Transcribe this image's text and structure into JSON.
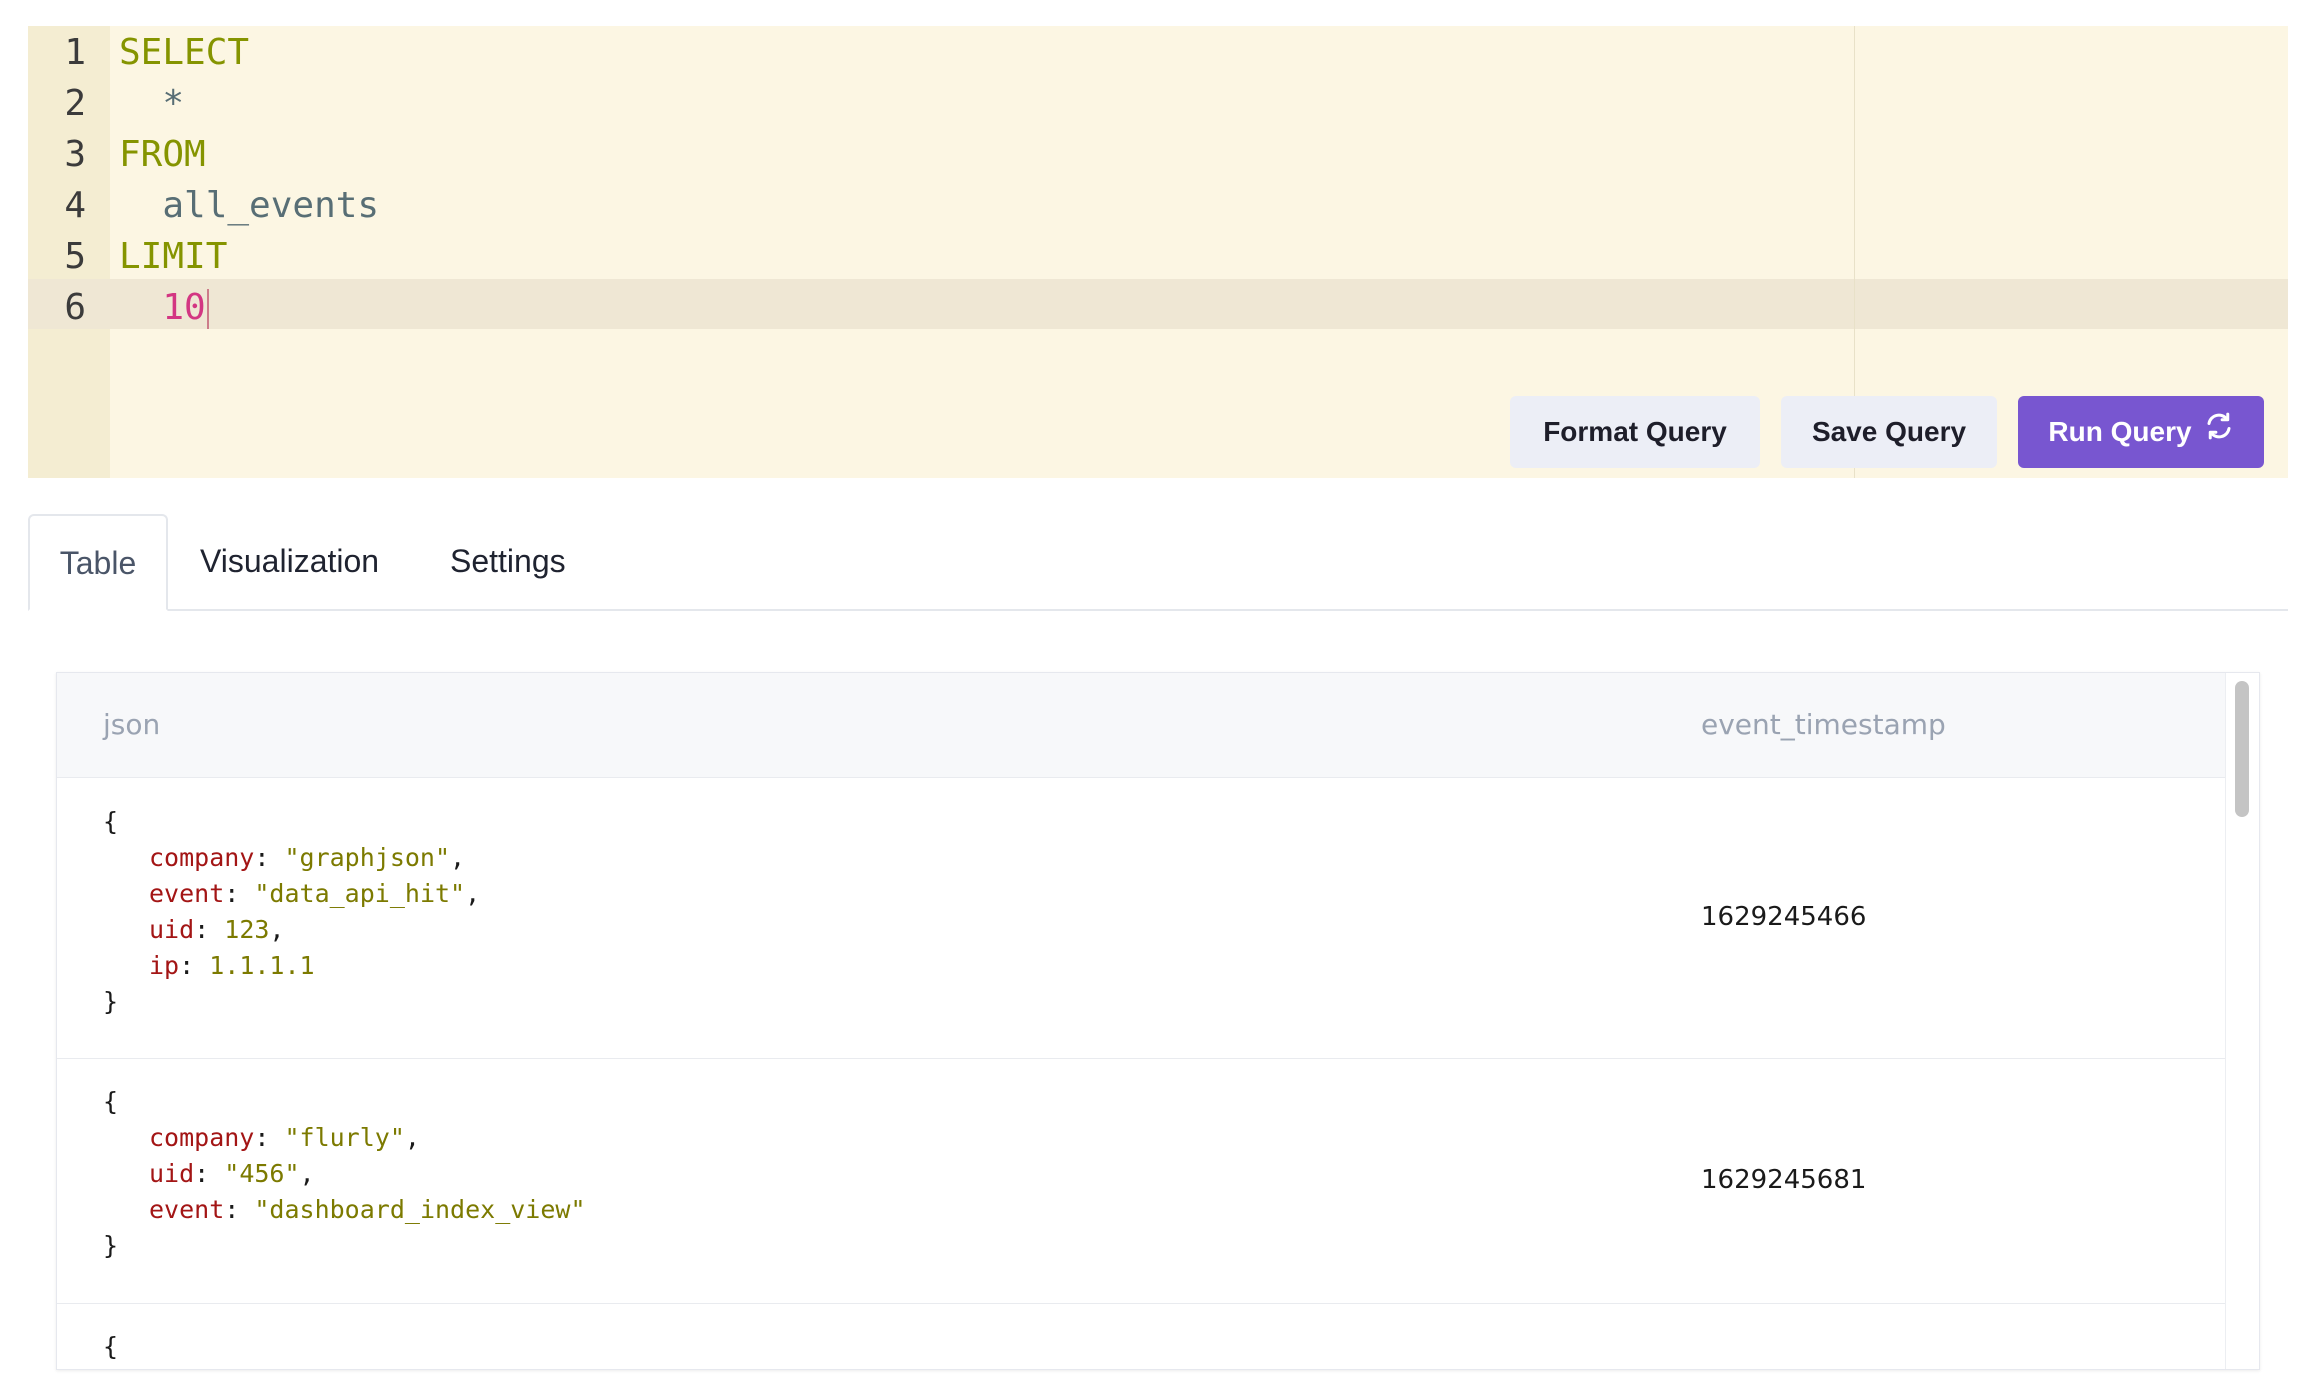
{
  "editor": {
    "lines": [
      {
        "num": "1",
        "indent": "",
        "text": "SELECT",
        "kind": "keyword"
      },
      {
        "num": "2",
        "indent": "  ",
        "text": "*",
        "kind": "identifier"
      },
      {
        "num": "3",
        "indent": "",
        "text": "FROM",
        "kind": "keyword"
      },
      {
        "num": "4",
        "indent": "  ",
        "text": "all_events",
        "kind": "identifier"
      },
      {
        "num": "5",
        "indent": "",
        "text": "LIMIT",
        "kind": "keyword"
      },
      {
        "num": "6",
        "indent": "  ",
        "text": "10",
        "kind": "number"
      }
    ],
    "colors": {
      "background": "#fcf6e3",
      "keyword": "#859400",
      "identifier": "#586e75",
      "number": "#d33682"
    }
  },
  "toolbar": {
    "format_label": "Format Query",
    "save_label": "Save Query",
    "run_label": "Run Query",
    "run_icon": "refresh-icon",
    "accent": "#7856d0"
  },
  "tabs": [
    {
      "label": "Table",
      "active": true
    },
    {
      "label": "Visualization",
      "active": false
    },
    {
      "label": "Settings",
      "active": false
    }
  ],
  "table": {
    "columns": [
      "json",
      "event_timestamp"
    ],
    "rows": [
      {
        "json_open": "{",
        "fields": [
          {
            "key": "company",
            "value": "\"graphjson\"",
            "sep": ","
          },
          {
            "key": "event",
            "value": "\"data_api_hit\"",
            "sep": ","
          },
          {
            "key": "uid",
            "value": "123",
            "sep": ","
          },
          {
            "key": "ip",
            "value": "1.1.1.1",
            "sep": ""
          }
        ],
        "json_close": "}",
        "timestamp": "1629245466"
      },
      {
        "json_open": "{",
        "fields": [
          {
            "key": "company",
            "value": "\"flurly\"",
            "sep": ","
          },
          {
            "key": "uid",
            "value": "\"456\"",
            "sep": ","
          },
          {
            "key": "event",
            "value": "\"dashboard_index_view\"",
            "sep": ""
          }
        ],
        "json_close": "}",
        "timestamp": "1629245681"
      },
      {
        "json_open": "{",
        "fields": [],
        "json_close": "",
        "timestamp": ""
      }
    ]
  }
}
